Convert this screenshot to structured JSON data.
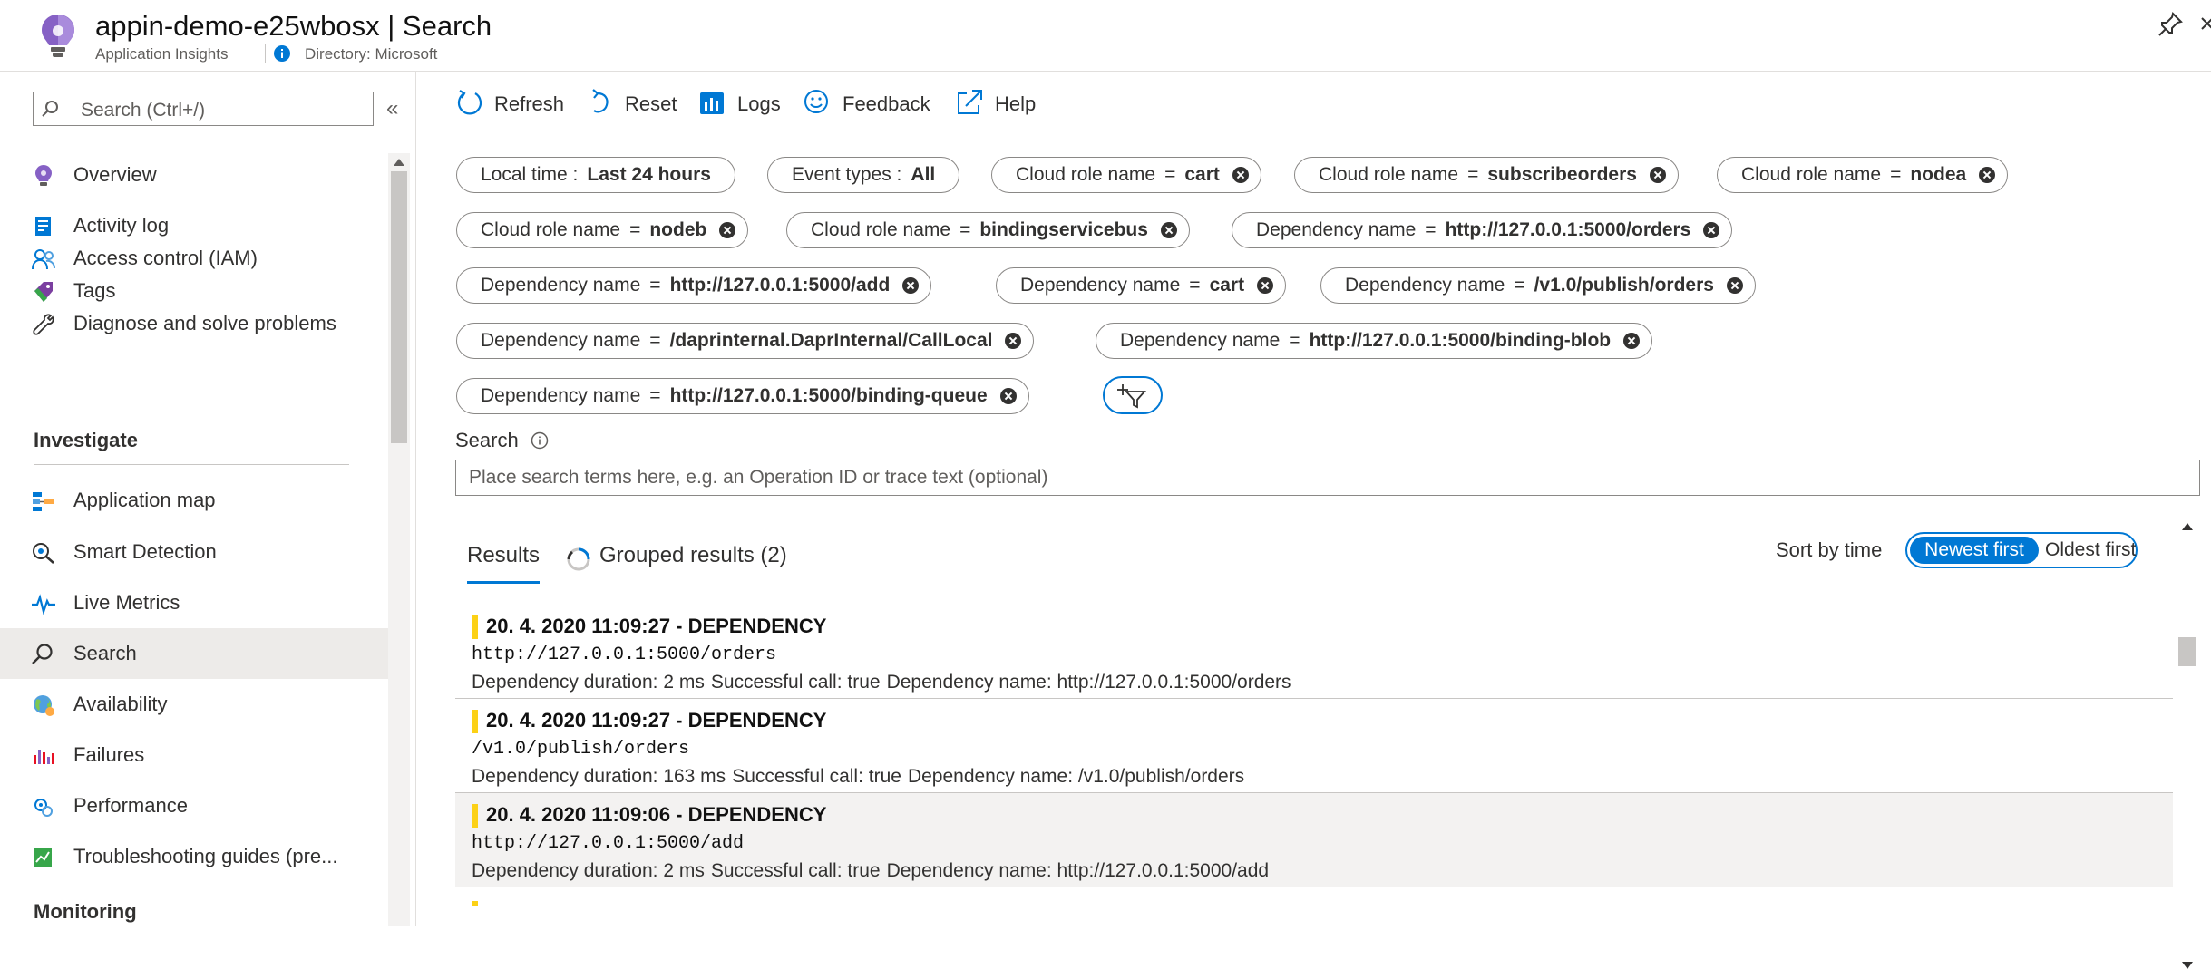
{
  "header": {
    "title": "appin-demo-e25wbosx | Search",
    "subtitle": "Application Insights",
    "directory": "Directory: Microsoft"
  },
  "sidebar": {
    "search_placeholder": "Search (Ctrl+/)",
    "collapse_glyph": "«",
    "items": [
      {
        "label": "Overview",
        "icon": "bulb-icon"
      },
      {
        "label": "Activity log",
        "icon": "activity-log-icon"
      },
      {
        "label": "Access control (IAM)",
        "icon": "people-icon"
      },
      {
        "label": "Tags",
        "icon": "tag-icon"
      },
      {
        "label": "Diagnose and solve problems",
        "icon": "wrench-icon"
      }
    ],
    "investigate_title": "Investigate",
    "investigate_items": [
      {
        "label": "Application map",
        "icon": "app-map-icon"
      },
      {
        "label": "Smart Detection",
        "icon": "smart-detection-icon"
      },
      {
        "label": "Live Metrics",
        "icon": "pulse-icon"
      },
      {
        "label": "Search",
        "icon": "search-icon",
        "active": true
      },
      {
        "label": "Availability",
        "icon": "globe-icon"
      },
      {
        "label": "Failures",
        "icon": "failures-icon"
      },
      {
        "label": "Performance",
        "icon": "performance-icon"
      },
      {
        "label": "Troubleshooting guides (pre...",
        "icon": "guide-icon"
      }
    ],
    "monitoring_title": "Monitoring"
  },
  "toolbar": {
    "refresh": "Refresh",
    "reset": "Reset",
    "logs": "Logs",
    "feedback": "Feedback",
    "help": "Help"
  },
  "filters": {
    "time": {
      "key": "Local time :",
      "value": "Last 24 hours"
    },
    "event_types": {
      "key": "Event types :",
      "value": "All"
    },
    "chips": [
      {
        "key": "Cloud role name",
        "value": "cart"
      },
      {
        "key": "Cloud role name",
        "value": "subscribeorders"
      },
      {
        "key": "Cloud role name",
        "value": "nodea"
      },
      {
        "key": "Cloud role name",
        "value": "nodeb"
      },
      {
        "key": "Cloud role name",
        "value": "bindingservicebus"
      },
      {
        "key": "Dependency name",
        "value": "http://127.0.0.1:5000/orders"
      },
      {
        "key": "Dependency name",
        "value": "http://127.0.0.1:5000/add"
      },
      {
        "key": "Dependency name",
        "value": "cart"
      },
      {
        "key": "Dependency name",
        "value": "/v1.0/publish/orders"
      },
      {
        "key": "Dependency name",
        "value": "/daprinternal.DaprInternal/CallLocal"
      },
      {
        "key": "Dependency name",
        "value": "http://127.0.0.1:5000/binding-blob"
      },
      {
        "key": "Dependency name",
        "value": "http://127.0.0.1:5000/binding-queue"
      }
    ],
    "eq": "="
  },
  "search": {
    "label": "Search",
    "placeholder": "Place search terms here, e.g. an Operation ID or trace text (optional)",
    "value": ""
  },
  "tabs": {
    "results": "Results",
    "grouped": "Grouped results (2)"
  },
  "sort": {
    "label": "Sort by time",
    "newest": "Newest first",
    "oldest": "Oldest first",
    "selected": "Newest first"
  },
  "results": [
    {
      "header": "20. 4. 2020 11:09:27 - DEPENDENCY",
      "target": "http://127.0.0.1:5000/orders",
      "duration": "Dependency duration: 2 ms",
      "success": "Successful call: true",
      "name": "Dependency name: http://127.0.0.1:5000/orders"
    },
    {
      "header": "20. 4. 2020 11:09:27 - DEPENDENCY",
      "target": "/v1.0/publish/orders",
      "duration": "Dependency duration: 163 ms",
      "success": "Successful call: true",
      "name": "Dependency name: /v1.0/publish/orders"
    },
    {
      "header": "20. 4. 2020 11:09:06 - DEPENDENCY",
      "target": "http://127.0.0.1:5000/add",
      "duration": "Dependency duration: 2 ms",
      "success": "Successful call: true",
      "name": "Dependency name: http://127.0.0.1:5000/add"
    }
  ],
  "colors": {
    "accent": "#0078d4",
    "dependency_marker": "#fcd116",
    "selected_row": "#edebe9"
  }
}
